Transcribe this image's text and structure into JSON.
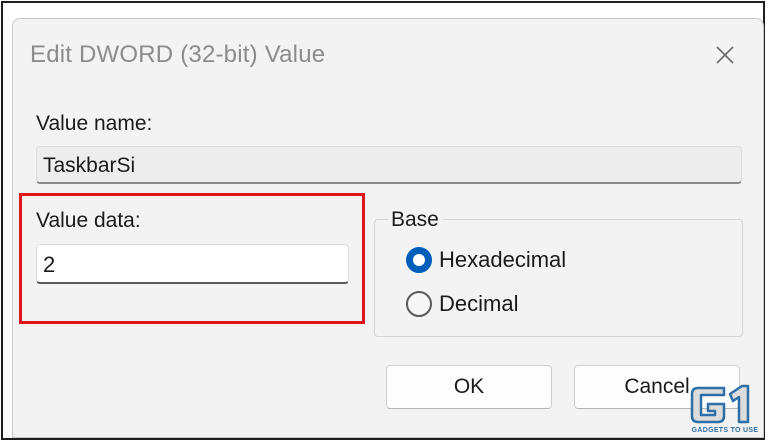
{
  "dialog": {
    "title": "Edit DWORD (32-bit) Value",
    "close_icon": "close-icon"
  },
  "value_name": {
    "label": "Value name:",
    "value": "TaskbarSi"
  },
  "value_data": {
    "label": "Value data:",
    "value": "2",
    "highlight_color": "#e0161e"
  },
  "base": {
    "legend": "Base",
    "options": [
      {
        "label": "Hexadecimal",
        "checked": true
      },
      {
        "label": "Decimal",
        "checked": false
      }
    ],
    "accent_color": "#005fb8"
  },
  "buttons": {
    "ok_label": "OK",
    "cancel_label": "Cancel"
  },
  "watermark": {
    "caption": "GADGETS TO USE",
    "icon": "g1-logo-icon"
  }
}
